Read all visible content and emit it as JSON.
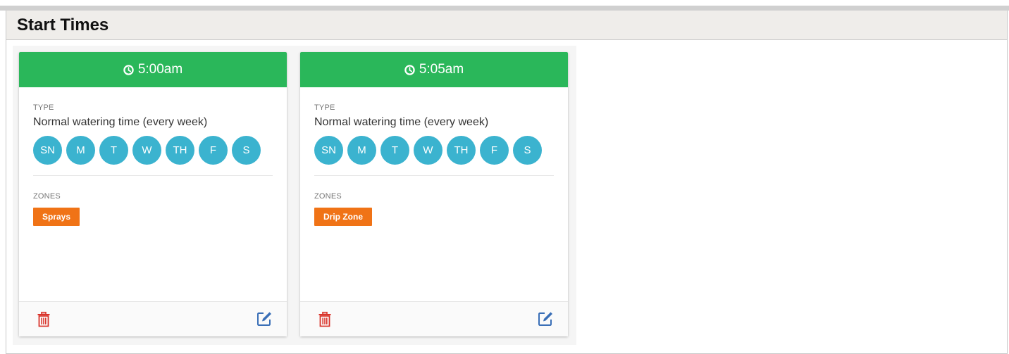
{
  "panel": {
    "title": "Start Times"
  },
  "cards": [
    {
      "time": "5:00am",
      "type_label": "TYPE",
      "type_value": "Normal watering time (every week)",
      "days": [
        "SN",
        "M",
        "T",
        "W",
        "TH",
        "F",
        "S"
      ],
      "zones_label": "ZONES",
      "zones": [
        "Sprays"
      ]
    },
    {
      "time": "5:05am",
      "type_label": "TYPE",
      "type_value": "Normal watering time (every week)",
      "days": [
        "SN",
        "M",
        "T",
        "W",
        "TH",
        "F",
        "S"
      ],
      "zones_label": "ZONES",
      "zones": [
        "Drip Zone"
      ]
    }
  ],
  "icons": {
    "clock": "clock-icon",
    "delete": "trash-icon",
    "edit": "edit-icon"
  },
  "colors": {
    "card_header": "#2ab75a",
    "day_circle": "#3bb3cf",
    "zone_tag": "#f07316",
    "delete_icon": "#d9342b",
    "edit_icon": "#3a6fb7"
  }
}
